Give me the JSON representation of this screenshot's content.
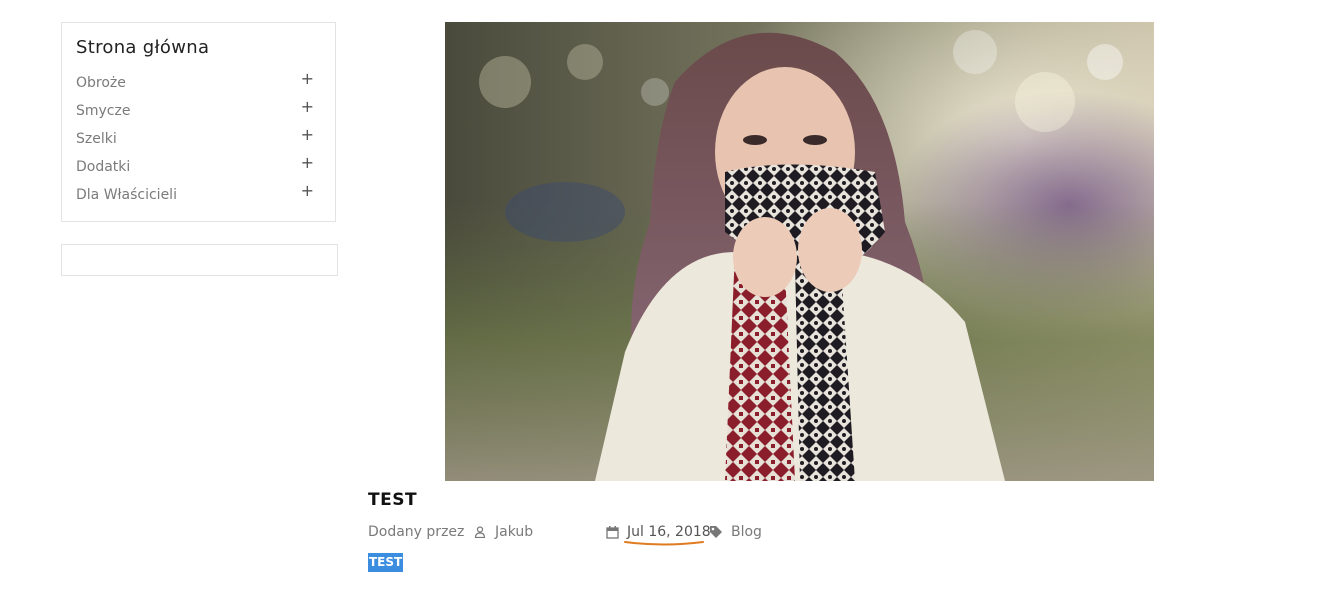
{
  "sidebar": {
    "title": "Strona główna",
    "categories": [
      {
        "label": "Obroże",
        "toggle": "+"
      },
      {
        "label": "Smycze",
        "toggle": "+"
      },
      {
        "label": "Szelki",
        "toggle": "+"
      },
      {
        "label": "Dodatki",
        "toggle": "+"
      },
      {
        "label": "Dla Właścicieli",
        "toggle": "+"
      }
    ]
  },
  "post": {
    "image_alt": "woman covering face with knitted scarf",
    "title": "TEST",
    "added_by_label": "Dodany przez",
    "author": "Jakub",
    "date": "Jul 16, 2018",
    "tag": "Blog",
    "excerpt": "TEST"
  },
  "icons": {
    "author": "user-icon",
    "date": "calendar-icon",
    "tag": "tag-icon"
  },
  "colors": {
    "selection_highlight": "#3b8de0",
    "date_underline": "#e07b20",
    "border": "#e3e3e3"
  }
}
